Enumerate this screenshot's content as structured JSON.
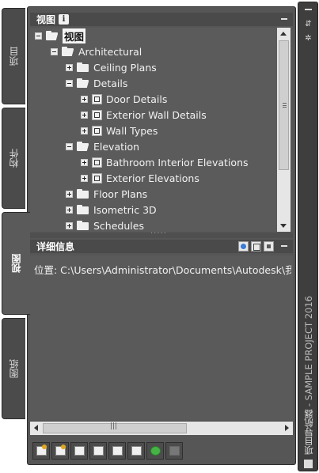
{
  "left_tabs": [
    {
      "label": "项目",
      "active": false
    },
    {
      "label": "构件",
      "active": false
    },
    {
      "label": "视图",
      "active": true
    },
    {
      "label": "图纸",
      "active": false
    }
  ],
  "views_panel": {
    "title": "视图",
    "info_icon_text": "i",
    "tree": [
      {
        "label": "视图",
        "level": 0,
        "expander": "minus",
        "icon": "folder-open",
        "selected": true
      },
      {
        "label": "Architectural",
        "level": 1,
        "expander": "minus",
        "icon": "folder-open"
      },
      {
        "label": "Ceiling Plans",
        "level": 2,
        "expander": "plus",
        "icon": "folder"
      },
      {
        "label": "Details",
        "level": 2,
        "expander": "minus",
        "icon": "folder-open"
      },
      {
        "label": "Door Details",
        "level": 3,
        "expander": "plus",
        "icon": "view"
      },
      {
        "label": "Exterior Wall Details",
        "level": 3,
        "expander": "plus",
        "icon": "view"
      },
      {
        "label": "Wall Types",
        "level": 3,
        "expander": "plus",
        "icon": "view"
      },
      {
        "label": "Elevation",
        "level": 2,
        "expander": "minus",
        "icon": "folder-open"
      },
      {
        "label": "Bathroom Interior Elevations",
        "level": 3,
        "expander": "plus",
        "icon": "view"
      },
      {
        "label": "Exterior Elevations",
        "level": 3,
        "expander": "plus",
        "icon": "view"
      },
      {
        "label": "Floor Plans",
        "level": 2,
        "expander": "plus",
        "icon": "folder"
      },
      {
        "label": "Isometric 3D",
        "level": 2,
        "expander": "plus",
        "icon": "folder"
      },
      {
        "label": "Schedules",
        "level": 2,
        "expander": "plus",
        "icon": "folder"
      }
    ]
  },
  "details_panel": {
    "title": "详细信息",
    "location_text": "位置: C:\\Users\\Administrator\\Documents\\Autodesk\\我的项目"
  },
  "toolbar_icons": [
    "new-view-icon",
    "open-view-icon",
    "properties-icon",
    "copy-icon",
    "cursor-icon",
    "schedule-icon",
    "refresh-icon",
    "disabled-icon"
  ],
  "right_strip": {
    "title": "项目导航器",
    "product": "SAMPLE PROJECT 2016",
    "separator": " - "
  }
}
